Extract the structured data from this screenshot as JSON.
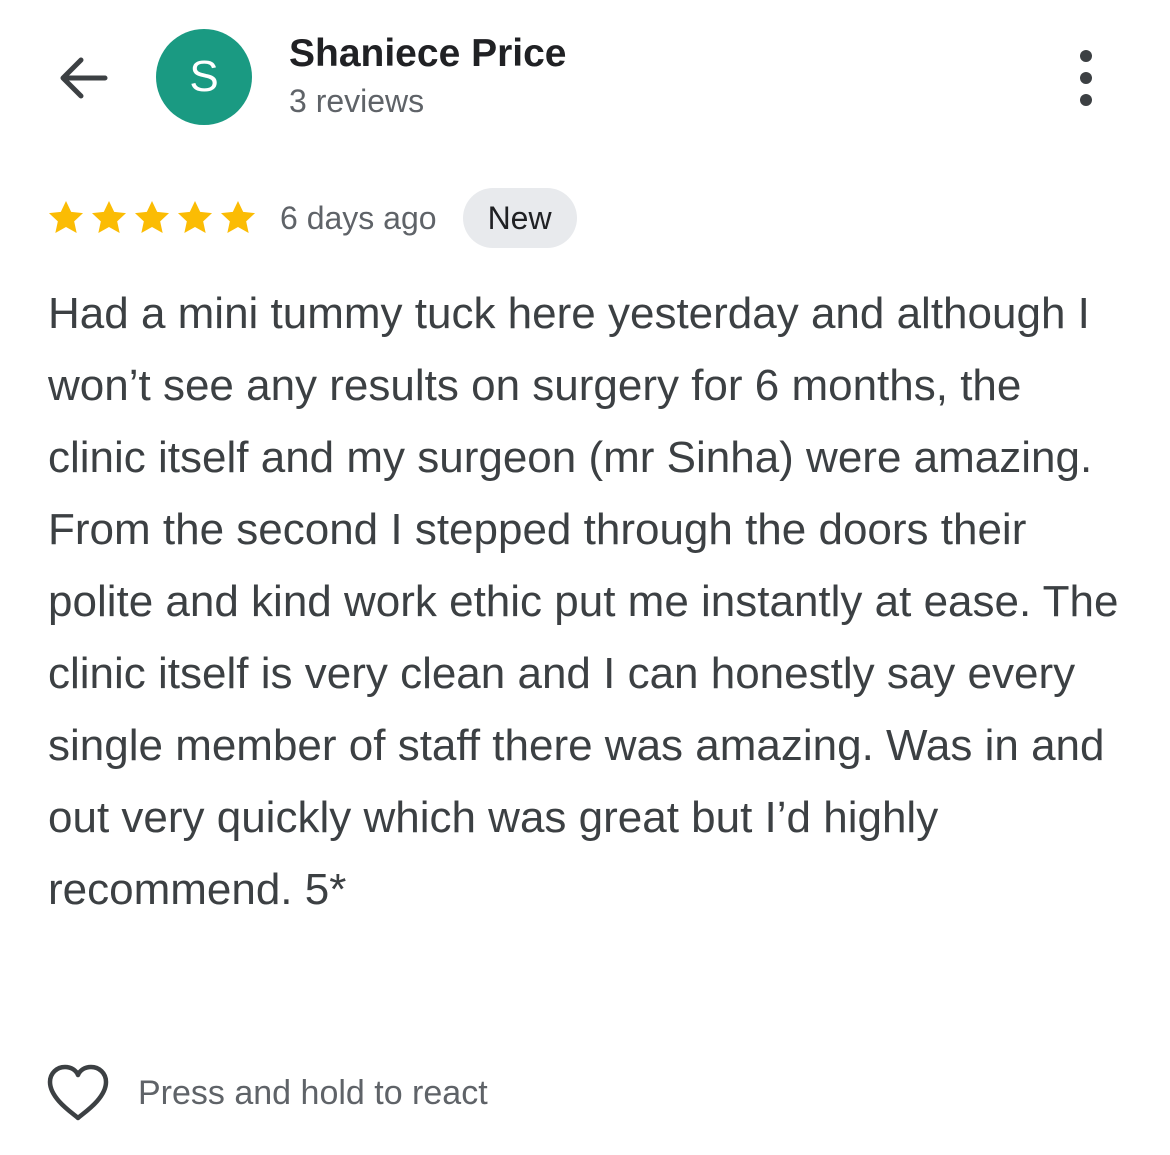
{
  "header": {
    "back_icon": "arrow-back-icon",
    "avatar_initial": "S",
    "avatar_color": "#1a9a82",
    "name": "Shaniece Price",
    "review_count": "3 reviews",
    "more_icon": "more-vertical-icon"
  },
  "review": {
    "rating": 5,
    "rating_max": 5,
    "star_color": "#fbbc04",
    "time_ago": "6 days ago",
    "badge": "New",
    "badge_color": "#e8eaed",
    "text": "Had a mini tummy tuck here yesterday and although I won’t see any results on surgery for 6 months, the clinic itself and my surgeon (mr Sinha) were amazing. From the second I stepped through the doors their polite and kind work ethic put me instantly at ease. The clinic itself is very clean and I can honestly say every single member of staff there was amazing. Was in and out very quickly which was great but I’d highly recommend. 5*"
  },
  "footer": {
    "react_icon": "heart-outline-icon",
    "react_label": "Press and hold to react"
  }
}
